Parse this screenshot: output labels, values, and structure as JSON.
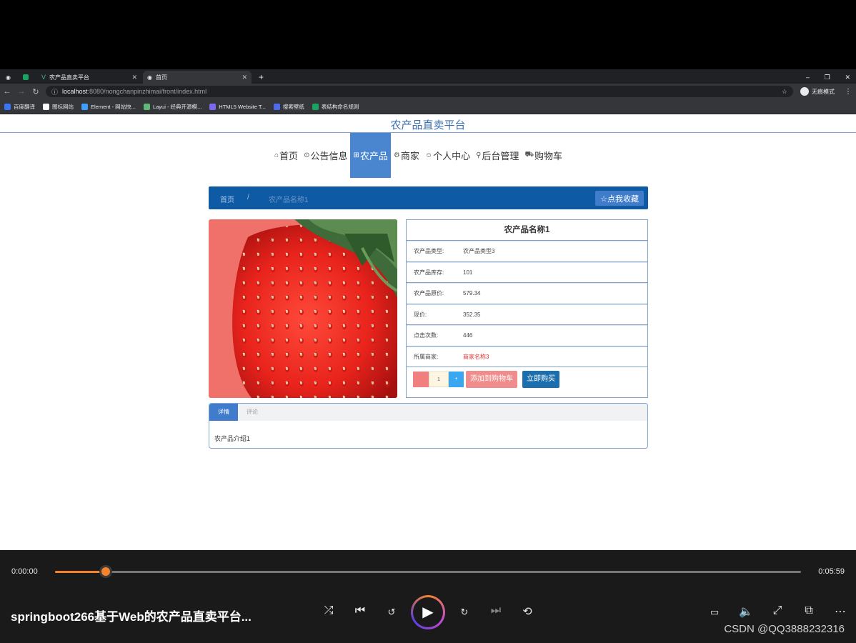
{
  "browser": {
    "tabs": [
      {
        "label": ""
      },
      {
        "label": "农产品直卖平台"
      },
      {
        "label": "首页"
      }
    ],
    "url_host": "localhost",
    "url_rest": ":8080/nongchanpinzhimai/front/index.html",
    "profile_label": "无痕模式",
    "bookmarks": [
      {
        "label": "百度翻译",
        "color": "#3875f6"
      },
      {
        "label": "图标网站",
        "color": "#ffffff"
      },
      {
        "label": "Element - 网站快...",
        "color": "#409eff"
      },
      {
        "label": "Layui - 经典开源模...",
        "color": "#5fb878"
      },
      {
        "label": "HTML5 Website T...",
        "color": "#7b68ee"
      },
      {
        "label": "搜索壁纸",
        "color": "#4f6bed"
      },
      {
        "label": "表结构命名规则",
        "color": "#1aa260"
      }
    ]
  },
  "site": {
    "title": "农产品直卖平台",
    "nav": [
      {
        "icon": "⌂",
        "label": "首页",
        "active": false
      },
      {
        "icon": "⊙",
        "label": "公告信息",
        "active": false
      },
      {
        "icon": "⊞",
        "label": "农产品",
        "active": true
      },
      {
        "icon": "⚙",
        "label": "商家",
        "active": false
      },
      {
        "icon": "☺",
        "label": "个人中心",
        "active": false
      },
      {
        "icon": "⚲",
        "label": "后台管理",
        "active": false
      },
      {
        "icon": "⛟",
        "label": "购物车",
        "active": false
      }
    ]
  },
  "breadcrumb": {
    "home": "首页",
    "separator": "/",
    "current": "农产品名称1",
    "favorite_label": "☆点我收藏"
  },
  "product": {
    "name": "农产品名称1",
    "rows": [
      {
        "label": "农产品类型:",
        "value": "农产品类型3"
      },
      {
        "label": "农产品库存:",
        "value": "101"
      },
      {
        "label": "农产品原价:",
        "value": "579.34"
      },
      {
        "label": "现价:",
        "value": "352.35"
      },
      {
        "label": "点击次数:",
        "value": "446"
      },
      {
        "label": "所属商家:",
        "value": "商家名称3"
      }
    ],
    "quantity": "1",
    "minus_label": "",
    "plus_label": "+",
    "add_cart_label": "添加到购物车",
    "buy_label": "立即购买"
  },
  "detail_tabs": {
    "tabs": [
      "详情",
      "评论"
    ],
    "content": "农产品介绍1"
  },
  "player": {
    "current_time": "0:00:00",
    "total_time": "0:05:59",
    "progress": 0.068,
    "title": "springboot266基于Web的农产品直卖平台...",
    "watermark": "CSDN @QQ3888232316"
  },
  "colors": {
    "accent": "#4a86d0",
    "breadcrumb_bg": "#0f5aa5",
    "player_accent": "#f5832b"
  }
}
